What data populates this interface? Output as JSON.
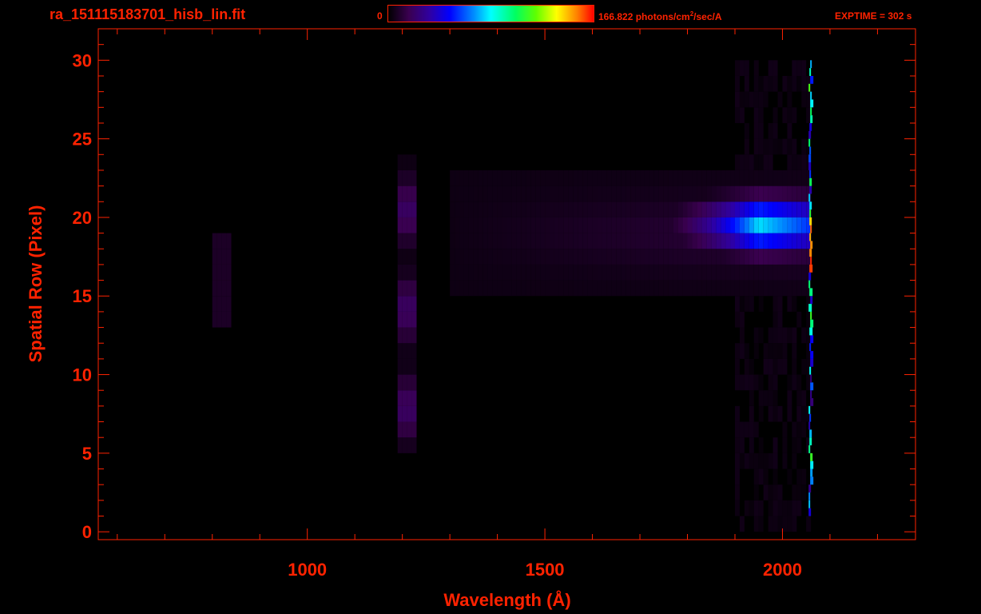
{
  "header": {
    "filename": "ra_151115183701_hisb_lin.fit",
    "colorbar_min": "0",
    "colorbar_max_value": "166.822 photons/cm",
    "colorbar_max_sup": "2",
    "colorbar_max_unit": "/sec/A",
    "exptime": "EXPTIME = 302 s"
  },
  "colors": {
    "axis": "#ff2200",
    "background": "#000000"
  },
  "chart_data": {
    "type": "heatmap",
    "title": "ra_151115183701_hisb_lin.fit",
    "xlabel": "Wavelength (Å)",
    "ylabel": "Spatial Row (Pixel)",
    "xlim": [
      560,
      2280
    ],
    "ylim": [
      -0.5,
      32
    ],
    "x_ticks": [
      1000,
      1500,
      2000
    ],
    "y_ticks": [
      0,
      5,
      10,
      15,
      20,
      25,
      30
    ],
    "colorbar": {
      "min": 0,
      "max": 166.822,
      "unit": "photons/cm^2/sec/A",
      "colormap": "rainbow"
    },
    "features": [
      {
        "name": "bright-band",
        "x_range": [
          1650,
          2060
        ],
        "y_range": [
          16.5,
          22
        ],
        "peak_x": 1950,
        "peak_y": 19.5,
        "peak_value": 80
      },
      {
        "name": "left-streak",
        "x_range": [
          1190,
          1230
        ],
        "y_range": [
          5,
          24
        ],
        "value": 20
      },
      {
        "name": "faint-streak",
        "x_range": [
          800,
          840
        ],
        "y_range": [
          13,
          19
        ],
        "value": 8
      },
      {
        "name": "edge-spike",
        "x_range": [
          2055,
          2085
        ],
        "y_range": [
          0.5,
          30
        ],
        "peak_value": 166.822
      }
    ]
  }
}
